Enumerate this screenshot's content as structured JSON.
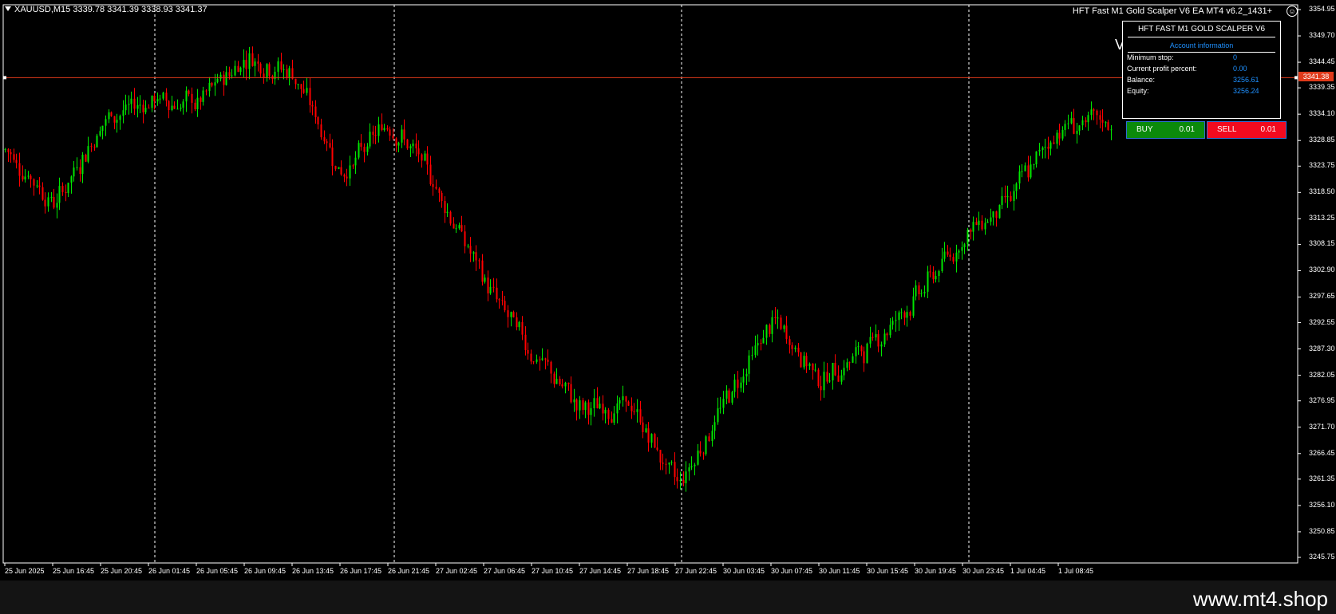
{
  "header": {
    "symbol_info": "XAUUSD,M15  3339.78 3341.39 3338.93 3341.37"
  },
  "ea": {
    "name": "HFT Fast M1 Gold Scalper V6 EA MT4 v6.2_1431+",
    "overlay_letter": "V"
  },
  "panel": {
    "title": "HFT FAST M1 GOLD SCALPER V6",
    "subtitle": "Account information",
    "rows": [
      {
        "label": "Minimum stop:",
        "value": "0"
      },
      {
        "label": "Current profit percent:",
        "value": "0.00"
      },
      {
        "label": "Balance:",
        "value": "3256.61"
      },
      {
        "label": "Equity:",
        "value": "3256.24"
      }
    ],
    "buy": {
      "label": "BUY",
      "lot": "0.01"
    },
    "sell": {
      "label": "SELL",
      "lot": "0.01"
    }
  },
  "price_line": {
    "value": "3341.38",
    "color": "#e03a1a"
  },
  "colors": {
    "bull": "#00e600",
    "bear": "#ff0000",
    "background": "#000000",
    "grid": "#ffffff"
  },
  "y_axis": [
    "3354.95",
    "3349.70",
    "3344.45",
    "3339.35",
    "3334.10",
    "3328.85",
    "3323.75",
    "3318.50",
    "3313.25",
    "3308.15",
    "3302.90",
    "3297.65",
    "3292.55",
    "3287.30",
    "3282.05",
    "3276.95",
    "3271.70",
    "3266.45",
    "3261.35",
    "3256.10",
    "3250.85",
    "3245.75"
  ],
  "x_axis": [
    "25 Jun 2025",
    "25 Jun 16:45",
    "25 Jun 20:45",
    "26 Jun 01:45",
    "26 Jun 05:45",
    "26 Jun 09:45",
    "26 Jun 13:45",
    "26 Jun 17:45",
    "26 Jun 21:45",
    "27 Jun 02:45",
    "27 Jun 06:45",
    "27 Jun 10:45",
    "27 Jun 14:45",
    "27 Jun 18:45",
    "27 Jun 22:45",
    "30 Jun 03:45",
    "30 Jun 07:45",
    "30 Jun 11:45",
    "30 Jun 15:45",
    "30 Jun 19:45",
    "30 Jun 23:45",
    "1 Jul 04:45",
    "1 Jul 08:45"
  ],
  "chart_data": {
    "type": "candlestick",
    "symbol": "XAUUSD",
    "timeframe": "M15",
    "ylim": [
      3245.75,
      3354.95
    ],
    "session_separators": [
      "26 Jun 01:45",
      "26 Jun 21:45",
      "27 Jun 22:45",
      "30 Jun 23:45"
    ],
    "last_price": 3341.38,
    "close_path": [
      [
        "25 Jun 2025",
        3327
      ],
      [
        "25 Jun 16:45",
        3316
      ],
      [
        "25 Jun 20:45",
        3333
      ],
      [
        "26 Jun 01:45",
        3337
      ],
      [
        "26 Jun 05:45",
        3336
      ],
      [
        "26 Jun 09:45",
        3346
      ],
      [
        "26 Jun 13:45",
        3342
      ],
      [
        "26 Jun 17:45",
        3322
      ],
      [
        "26 Jun 21:45",
        3333
      ],
      [
        "27 Jun 02:45",
        3319
      ],
      [
        "27 Jun 06:45",
        3300
      ],
      [
        "27 Jun 10:45",
        3286
      ],
      [
        "27 Jun 14:45",
        3275
      ],
      [
        "27 Jun 18:45",
        3276
      ],
      [
        "27 Jun 22:45",
        3260
      ],
      [
        "30 Jun 03:45",
        3277
      ],
      [
        "30 Jun 07:45",
        3293
      ],
      [
        "30 Jun 11:45",
        3281
      ],
      [
        "30 Jun 15:45",
        3288
      ],
      [
        "30 Jun 19:45",
        3298
      ],
      [
        "30 Jun 23:45",
        3310
      ],
      [
        "1 Jul 04:45",
        3318
      ],
      [
        "1 Jul 08:45",
        3332
      ]
    ]
  },
  "footer": {
    "watermark": "www.mt4.shop"
  }
}
